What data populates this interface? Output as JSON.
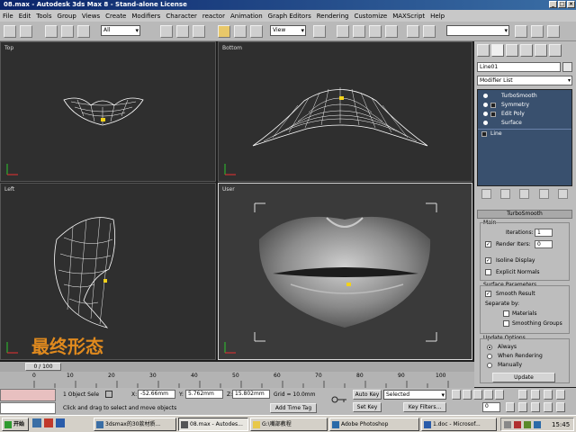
{
  "titlebar": {
    "title": "08.max - Autodesk 3ds Max 8 - Stand-alone License"
  },
  "menu": [
    "File",
    "Edit",
    "Tools",
    "Group",
    "Views",
    "Create",
    "Modifiers",
    "Character",
    "reactor",
    "Animation",
    "Graph Editors",
    "Rendering",
    "Customize",
    "MAXScript",
    "Help"
  ],
  "toolbar": {
    "selection_filter": "All",
    "ref_coord": "View"
  },
  "viewports": {
    "top": "Top",
    "bottom": "Bottom",
    "left": "Left",
    "user": "User",
    "caption": "最终形态"
  },
  "command_panel": {
    "object_name": "Line01",
    "modifier_list": "Modifier List",
    "stack": [
      {
        "label": "TurboSmooth",
        "type": "modifier"
      },
      {
        "label": "Symmetry",
        "type": "modifier"
      },
      {
        "label": "Edit Poly",
        "type": "modifier"
      },
      {
        "label": "Surface",
        "type": "modifier"
      },
      {
        "label": "Line",
        "type": "base"
      }
    ],
    "rollout_title": "TurboSmooth",
    "main_label": "Main",
    "iterations_label": "Iterations:",
    "iterations_value": "1",
    "render_iters_label": "Render Iters:",
    "render_iters_value": "0",
    "isoline_label": "Isoline Display",
    "explicit_normals_label": "Explicit Normals",
    "surface_params_label": "Surface Parameters",
    "smooth_result_label": "Smooth Result",
    "separate_by_label": "Separate by:",
    "materials_label": "Materials",
    "smoothing_groups_label": "Smoothing Groups",
    "update_options_label": "Update Options",
    "always_label": "Always",
    "when_rendering_label": "When Rendering",
    "manually_label": "Manually",
    "update_button": "Update"
  },
  "timeline": {
    "frame_display": "0 / 100",
    "ticks": [
      "0",
      "10",
      "20",
      "30",
      "40",
      "50",
      "60",
      "70",
      "80",
      "90",
      "100"
    ]
  },
  "status": {
    "selection": "1 Object Sele",
    "x_label": "X:",
    "x_value": "-52.66mm",
    "y_label": "Y:",
    "y_value": "5.762mm",
    "z_label": "Z:",
    "z_value": "15.802mm",
    "grid": "Grid = 10.0mm",
    "prompt": "Click and drag to select and move objects",
    "add_time_tag": "Add Time Tag",
    "auto_key": "Auto Key",
    "set_key": "Set Key",
    "key_filters": "Key Filters...",
    "selected": "Selected",
    "frame": "0"
  },
  "taskbar": {
    "start": "开始",
    "tasks": [
      "3dsmax的30款材质...",
      "08.max - Autodes...",
      "G:\\嘴部教程",
      "Adobe Photoshop",
      "1.doc - Microsof..."
    ],
    "time": "15:45"
  },
  "colors": {
    "accent": "#3a6ea5",
    "stack_bg": "#39506e",
    "caption": "#e08a1e"
  }
}
